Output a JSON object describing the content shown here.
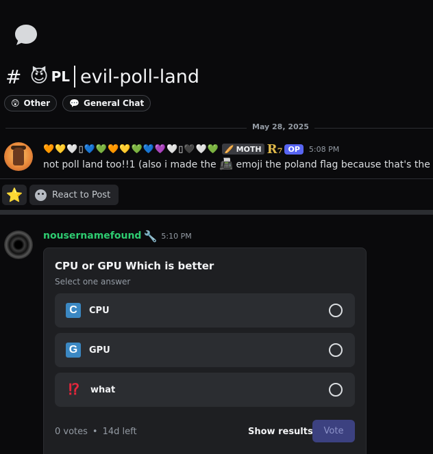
{
  "thread": {
    "icon": "chat-bubble-icon",
    "hash": "#",
    "emoji": "😈",
    "prefix": "PL",
    "name": "evil-poll-land",
    "tags": [
      {
        "emoji": "😲",
        "label": "Other"
      },
      {
        "emoji": "💬",
        "label": "General Chat"
      }
    ]
  },
  "date_divider": "May 28, 2025",
  "message1": {
    "name_decor": "🧡💛🤍▯💙💚🧡💛💚💙💜🤍▯🖤🤍💚",
    "tag_emoji": "🥖",
    "tag_label": "MOTH",
    "rune": "R₇",
    "op_label": "OP",
    "timestamp": "5:08 PM",
    "text_before": "not poll land too!!1 (also i made the ",
    "inline_emoji": "📠",
    "text_after": " emoji the poland flag because that's the corre"
  },
  "reactions": {
    "star_emoji": "⭐",
    "react_label": "React to Post"
  },
  "message2": {
    "username": "nousernamefound",
    "badge_emoji": "🔧",
    "timestamp": "5:10 PM",
    "poll": {
      "question": "CPU or GPU Which is better",
      "hint": "Select one answer",
      "options": [
        {
          "icon": "C",
          "label": "CPU"
        },
        {
          "icon": "G",
          "label": "GPU"
        },
        {
          "icon": "⁉",
          "label": "what"
        }
      ],
      "votes": "0 votes",
      "separator": "•",
      "time_left": "14d left",
      "show_results": "Show results",
      "vote": "Vote"
    }
  },
  "colors": {
    "background": "#0a0a0c",
    "username": "#2ecc71",
    "op_badge": "#5865f2",
    "vote_button": "#3c4180",
    "option_icon": "#3b88c3"
  }
}
